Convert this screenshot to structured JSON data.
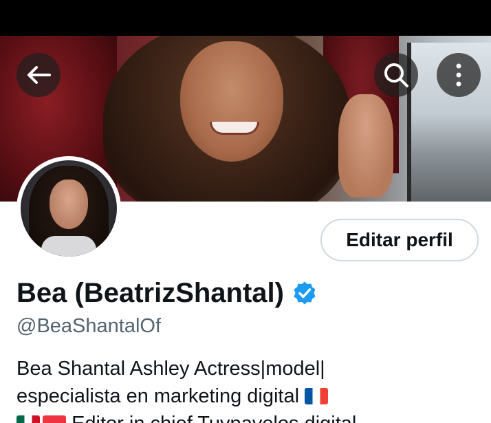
{
  "profile": {
    "display_name": "Bea (BeatrizShantal)",
    "handle": "@BeaShantalOf",
    "edit_button_label": "Editar perfil",
    "verified": true,
    "bio": {
      "line1": "Bea Shantal Ashley Actress|model|",
      "line2": "especialista en marketing digital",
      "line2_flag": "France",
      "line3_flags": [
        "Mexico",
        "Singapore"
      ],
      "line3": "Editor in chief Tuvpavelos digital"
    }
  },
  "header": {
    "back_icon": "arrow-left-icon",
    "search_icon": "search-icon",
    "more_icon": "more-vertical-icon"
  },
  "colors": {
    "text_primary": "#0f1419",
    "text_secondary": "#536471",
    "verified_blue": "#1d9bf0",
    "button_border": "#cfd9de"
  }
}
